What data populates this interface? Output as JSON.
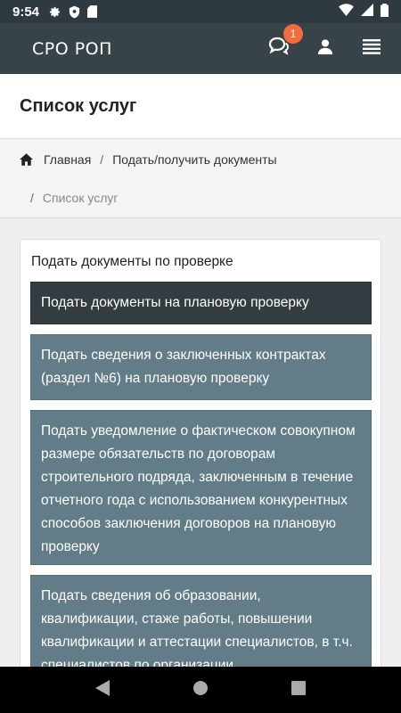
{
  "status_bar": {
    "time": "9:54",
    "left_icons": [
      "gear-icon",
      "shield-icon",
      "sd-card-icon"
    ],
    "right_icons": [
      "wifi-icon",
      "signal-icon",
      "battery-icon"
    ]
  },
  "header": {
    "logo": "СРО РОП",
    "notification_count": "1",
    "bg_color": "#374349",
    "badge_color": "#f26d3d"
  },
  "page": {
    "title": "Список услуг"
  },
  "breadcrumb": {
    "home": "Главная",
    "separator": "/",
    "documents": "Подать/получить документы",
    "current": "Список услуг"
  },
  "card": {
    "title": "Подать документы по проверке",
    "items": [
      {
        "label": "Подать документы на плановую проверку"
      },
      {
        "label": "Подать сведения о заключенных контрактах (раздел №6) на плановую проверку"
      },
      {
        "label": "Подать уведомление о фактическом совокупном размере обязательств по договорам строительного подряда, заключенным в течение отчетного года с использованием конкурентных способов заключения договоров на плановую проверку"
      },
      {
        "label": "Подать сведения об образовании, квалификации, стаже работы, повышении квалификации и аттестации специалистов, в т.ч. специалистов по организации"
      }
    ],
    "active_color": "#333c41",
    "item_color": "#627d88"
  }
}
